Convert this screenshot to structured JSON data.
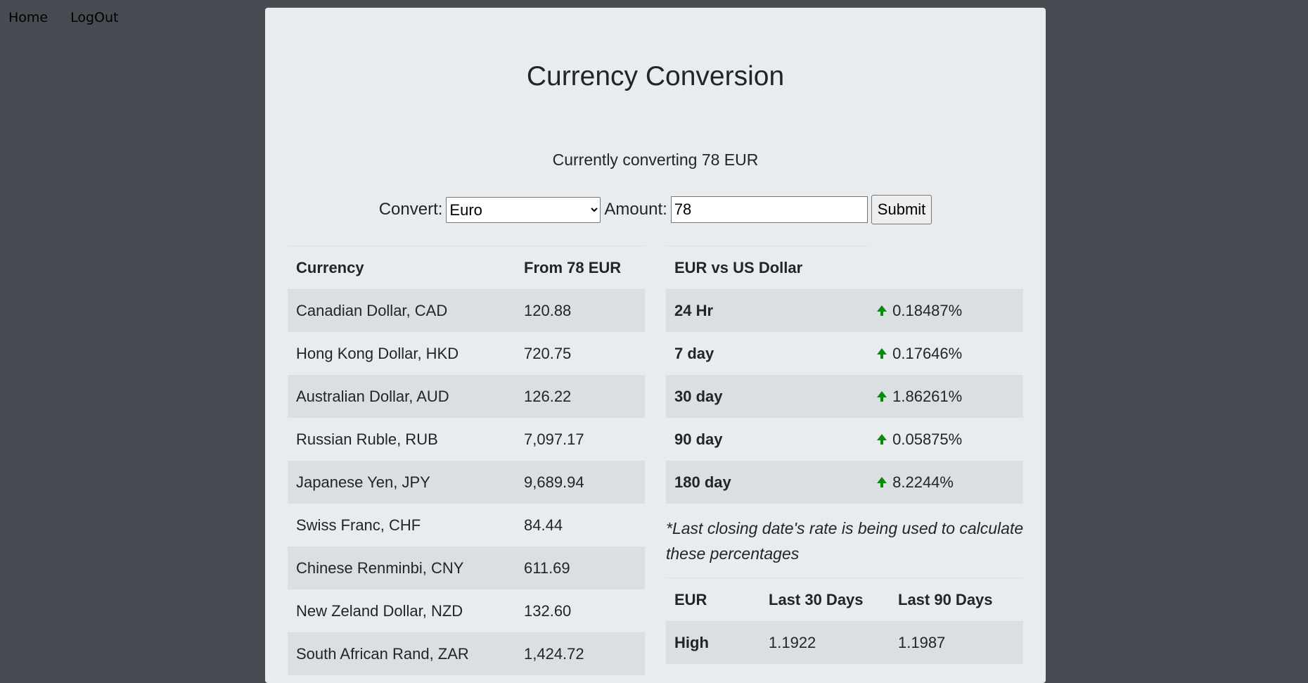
{
  "nav": {
    "home": "Home",
    "logout": "LogOut"
  },
  "page": {
    "title": "Currency Conversion",
    "subtitle": "Currently converting 78 EUR"
  },
  "form": {
    "convert_label": "Convert:",
    "currency_selected": "Euro",
    "amount_label": "Amount:",
    "amount_value": "78",
    "submit_label": "Submit"
  },
  "conversion_table": {
    "headers": [
      "Currency",
      "From 78 EUR"
    ],
    "rows": [
      {
        "currency": "Canadian Dollar, CAD",
        "value": "120.88"
      },
      {
        "currency": "Hong Kong Dollar, HKD",
        "value": "720.75"
      },
      {
        "currency": "Australian Dollar, AUD",
        "value": "126.22"
      },
      {
        "currency": "Russian Ruble, RUB",
        "value": "7,097.17"
      },
      {
        "currency": "Japanese Yen, JPY",
        "value": "9,689.94"
      },
      {
        "currency": "Swiss Franc, CHF",
        "value": "84.44"
      },
      {
        "currency": "Chinese Renminbi, CNY",
        "value": "611.69"
      },
      {
        "currency": "New Zeland Dollar, NZD",
        "value": "132.60"
      },
      {
        "currency": "South African Rand, ZAR",
        "value": "1,424.72"
      }
    ]
  },
  "rate_table": {
    "header": "EUR vs US Dollar",
    "rows": [
      {
        "period": "24 Hr",
        "change": "0.18487%",
        "direction": "up"
      },
      {
        "period": "7 day",
        "change": "0.17646%",
        "direction": "up"
      },
      {
        "period": "30 day",
        "change": "1.86261%",
        "direction": "up"
      },
      {
        "period": "90 day",
        "change": "0.05875%",
        "direction": "up"
      },
      {
        "period": "180 day",
        "change": "8.2244%",
        "direction": "up"
      }
    ],
    "arrow_color": "#0a8a0a"
  },
  "note": "*Last closing date's rate is being used to calculate these percentages",
  "history_table": {
    "headers": [
      "EUR",
      "Last 30 Days",
      "Last 90 Days"
    ],
    "rows": [
      {
        "label": "High",
        "d30": "1.1922",
        "d90": "1.1987"
      }
    ]
  }
}
